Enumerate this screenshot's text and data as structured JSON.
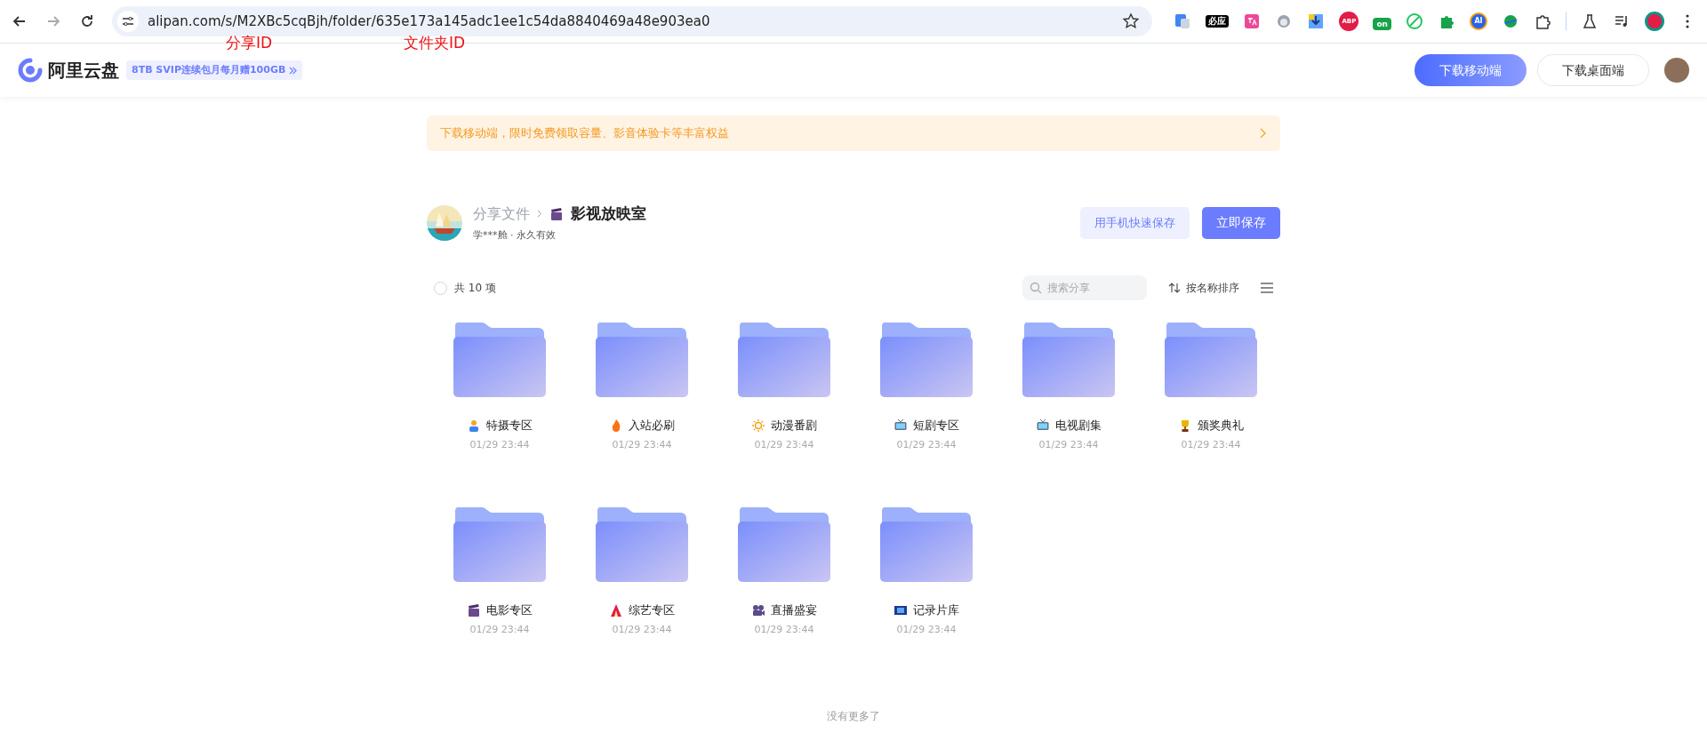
{
  "browser": {
    "url": "alipan.com/s/M2XBc5cqBjh/folder/635e173a145adc1ee1c54da8840469a48e903ea0",
    "extension_labels": [
      "必应",
      "ABP",
      "on",
      "AI"
    ]
  },
  "annotations": [
    "分享ID",
    "文件夹ID"
  ],
  "header": {
    "logo_text": "阿里云盘",
    "promo": "8TB SVIP连续包月每月赠100GB",
    "buttons": [
      "下载移动端",
      "下载桌面端"
    ]
  },
  "banner": {
    "text": "下载移动端，限时免费领取容量、影音体验卡等丰富权益"
  },
  "share": {
    "breadcrumb_root": "分享文件",
    "title": "影视放映室",
    "meta": "学***舱 · 永久有效",
    "buttons": [
      "用手机快速保存",
      "立即保存"
    ]
  },
  "toolbar": {
    "select_all": {
      "checked": false
    },
    "count": "共 10 项",
    "search": {
      "placeholder": "搜索分享"
    },
    "sort": "按名称排序"
  },
  "folders": [
    {
      "name": "特摄专区",
      "date": "01/29 23:44"
    },
    {
      "name": "入站必刷",
      "date": "01/29 23:44"
    },
    {
      "name": "动漫番剧",
      "date": "01/29 23:44"
    },
    {
      "name": "短剧专区",
      "date": "01/29 23:44"
    },
    {
      "name": "电视剧集",
      "date": "01/29 23:44"
    },
    {
      "name": "颁奖典礼",
      "date": "01/29 23:44"
    },
    {
      "name": "电影专区",
      "date": "01/29 23:44"
    },
    {
      "name": "综艺专区",
      "date": "01/29 23:44"
    },
    {
      "name": "直播盛宴",
      "date": "01/29 23:44"
    },
    {
      "name": "记录片库",
      "date": "01/29 23:44"
    }
  ],
  "footer": "没有更多了"
}
